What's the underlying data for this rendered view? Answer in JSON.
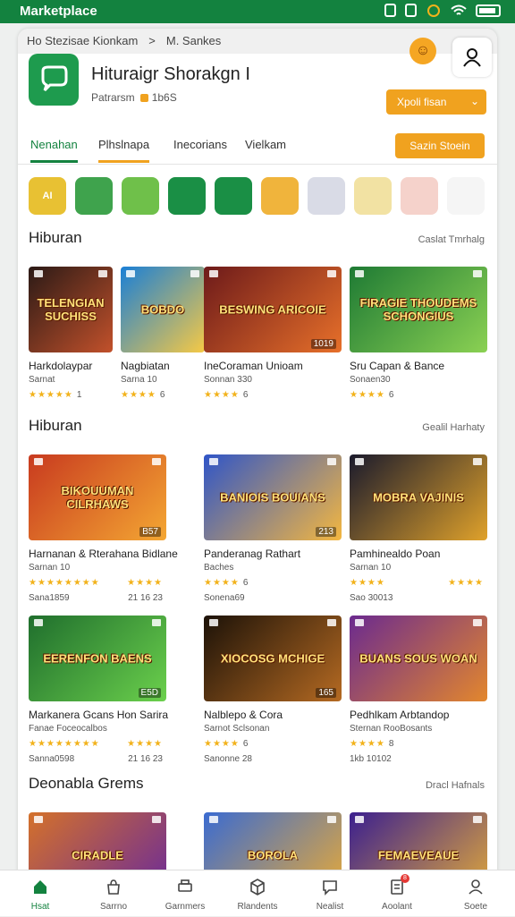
{
  "status_bar": {
    "title": "Marketplace"
  },
  "breadcrumb": {
    "part1": "Ho Stezisae Kionkam",
    "sep": ">",
    "part2": "M. Sankes"
  },
  "app": {
    "name": "Hituraigr Shorakgn",
    "cursor": "I",
    "meta_left": "Patrarsm",
    "meta_right": "1b6S",
    "install_label": "Xpoli fisan"
  },
  "tabs": [
    {
      "label": "Nenahan"
    },
    {
      "label": "Plhslnapa"
    },
    {
      "label": "Inecorians"
    },
    {
      "label": "Vielkam"
    }
  ],
  "save_button": {
    "label": "Sazin Stoein"
  },
  "mini_icons": [
    {
      "text": "AI",
      "color": "#e8c133"
    },
    {
      "text": "",
      "color": "#3fa34d"
    },
    {
      "text": "",
      "color": "#6fc04a"
    },
    {
      "text": "",
      "color": "#1a8f45"
    },
    {
      "text": "",
      "color": "#1a8f45"
    },
    {
      "text": "",
      "color": "#f0b43c"
    },
    {
      "text": "",
      "color": "#d9dbe6"
    },
    {
      "text": "",
      "color": "#f2e2a3"
    },
    {
      "text": "",
      "color": "#f5d2cb"
    },
    {
      "text": "",
      "color": "#f5f5f5"
    }
  ],
  "sections": [
    {
      "title": "Hiburan",
      "link": "Caslat Tmrhalg",
      "tiles": [
        {
          "thumb_text": "TELENGIAN SUCHISS",
          "name": "Harkdolaypar",
          "sub": "Sarnat",
          "rating_stars": "★★★★★",
          "rating_val": "1",
          "badge": "",
          "colors": [
            "#2b1a16",
            "#c2512b"
          ]
        },
        {
          "thumb_text": "BOBDO",
          "name": "Nagbiatan",
          "sub": "Sarna 10",
          "rating_stars": "★★★★",
          "rating_val": "6",
          "badge": "",
          "colors": [
            "#1a7fd6",
            "#f6c945"
          ]
        },
        {
          "thumb_text": "BESWING ARICOIE",
          "name": "IneCoraman Unioam",
          "sub": "Sonnan 330",
          "rating_stars": "★★★★",
          "rating_val": "6",
          "badge": "1019",
          "colors": [
            "#6d1a1a",
            "#e7702a"
          ]
        },
        {
          "thumb_text": "FIRAGIE THOUDEMS SCHONGIUS",
          "name": "Sru Capan & Bance",
          "sub": "Sonaen30",
          "rating_stars": "★★★★",
          "rating_val": "6",
          "badge": "",
          "colors": [
            "#1e7a34",
            "#8bd153"
          ]
        }
      ]
    },
    {
      "title": "Hiburan",
      "link": "Gealil Harhaty",
      "tiles": [
        {
          "thumb_text": "BIKOUUMAN CILRHAWS",
          "name": "Harnanan & Rterahana Bidlane",
          "sub": "Sarnan 10",
          "rating_stars": "★★★★★★★★",
          "rating_extra": "Sana1859",
          "rating_right": "★★★★",
          "extra_right": "21 16 23",
          "badge": "B57",
          "colors": [
            "#c83a1f",
            "#f4a733"
          ]
        },
        {
          "thumb_text": "BANIOIS BOUIANS",
          "name": "Panderanag Rathart",
          "sub": "Baches",
          "rating_stars": "★★★★",
          "rating_val": "6",
          "rating_extra": "Sonena69",
          "badge": "213",
          "colors": [
            "#2f55c8",
            "#f4b740"
          ]
        },
        {
          "thumb_text": "MOBRA VAJINIS",
          "name": "Pamhinealdo Poan",
          "sub": "Sarnan 10",
          "rating_stars": "★★★★",
          "rating_extra": "Sao 30013",
          "rating_right": "★★★★",
          "badge": "",
          "colors": [
            "#1a1a2c",
            "#e0a22b"
          ]
        }
      ]
    },
    {
      "title": "",
      "link": "",
      "tiles": [
        {
          "thumb_text": "EERENFON BAENS",
          "name": "Markanera Gcans Hon Sarira",
          "sub": "Fanae Foceocalbos",
          "rating_stars": "★★★★★★★★",
          "rating_right": "★★★★",
          "rating_extra": "Sanna0598",
          "extra_right": "21 16 23",
          "badge": "E5D",
          "colors": [
            "#1f6e2d",
            "#6bd04c"
          ]
        },
        {
          "thumb_text": "XIOCOSG MCHIGE",
          "name": "Nalblepo & Cora",
          "sub": "Sarnot Sclsonan",
          "rating_stars": "★★★★",
          "rating_val": "6",
          "rating_extra": "Sanonne 28",
          "badge": "165",
          "colors": [
            "#1c1208",
            "#b56a22"
          ]
        },
        {
          "thumb_text": "BUANS SOUS WOAN",
          "name": "Pedhlkam Arbtandop",
          "sub": "Sternan RooBosants",
          "rating_stars": "★★★★",
          "rating_val": "8",
          "rating_extra": "1kb 10102",
          "badge": "",
          "colors": [
            "#6b2a8f",
            "#e3872d"
          ]
        }
      ]
    },
    {
      "title": "Deonabla Grems",
      "link": "Dracl Hafnals",
      "tiles": [
        {
          "thumb_text": "CIRADLE",
          "colors": [
            "#d4712a",
            "#6a2a9a"
          ]
        },
        {
          "thumb_text": "BOROLA",
          "colors": [
            "#3a6bd1",
            "#e8aa37"
          ]
        },
        {
          "thumb_text": "FEMAEVEAUE",
          "colors": [
            "#3b1f8f",
            "#e1a93b"
          ]
        }
      ]
    }
  ],
  "bottom_nav": [
    {
      "label": "Hsat",
      "icon": "home-icon"
    },
    {
      "label": "Sarrno",
      "icon": "bag-icon"
    },
    {
      "label": "Garnmers",
      "icon": "printer-icon"
    },
    {
      "label": "Rlandents",
      "icon": "box-icon"
    },
    {
      "label": "Nealist",
      "icon": "chat-icon"
    },
    {
      "label": "Aoolant",
      "icon": "notes-icon",
      "badge": "8"
    },
    {
      "label": "Soete",
      "icon": "profile-icon"
    }
  ],
  "colors": {
    "brand_green": "#13823f",
    "accent_orange": "#f0a21f"
  }
}
